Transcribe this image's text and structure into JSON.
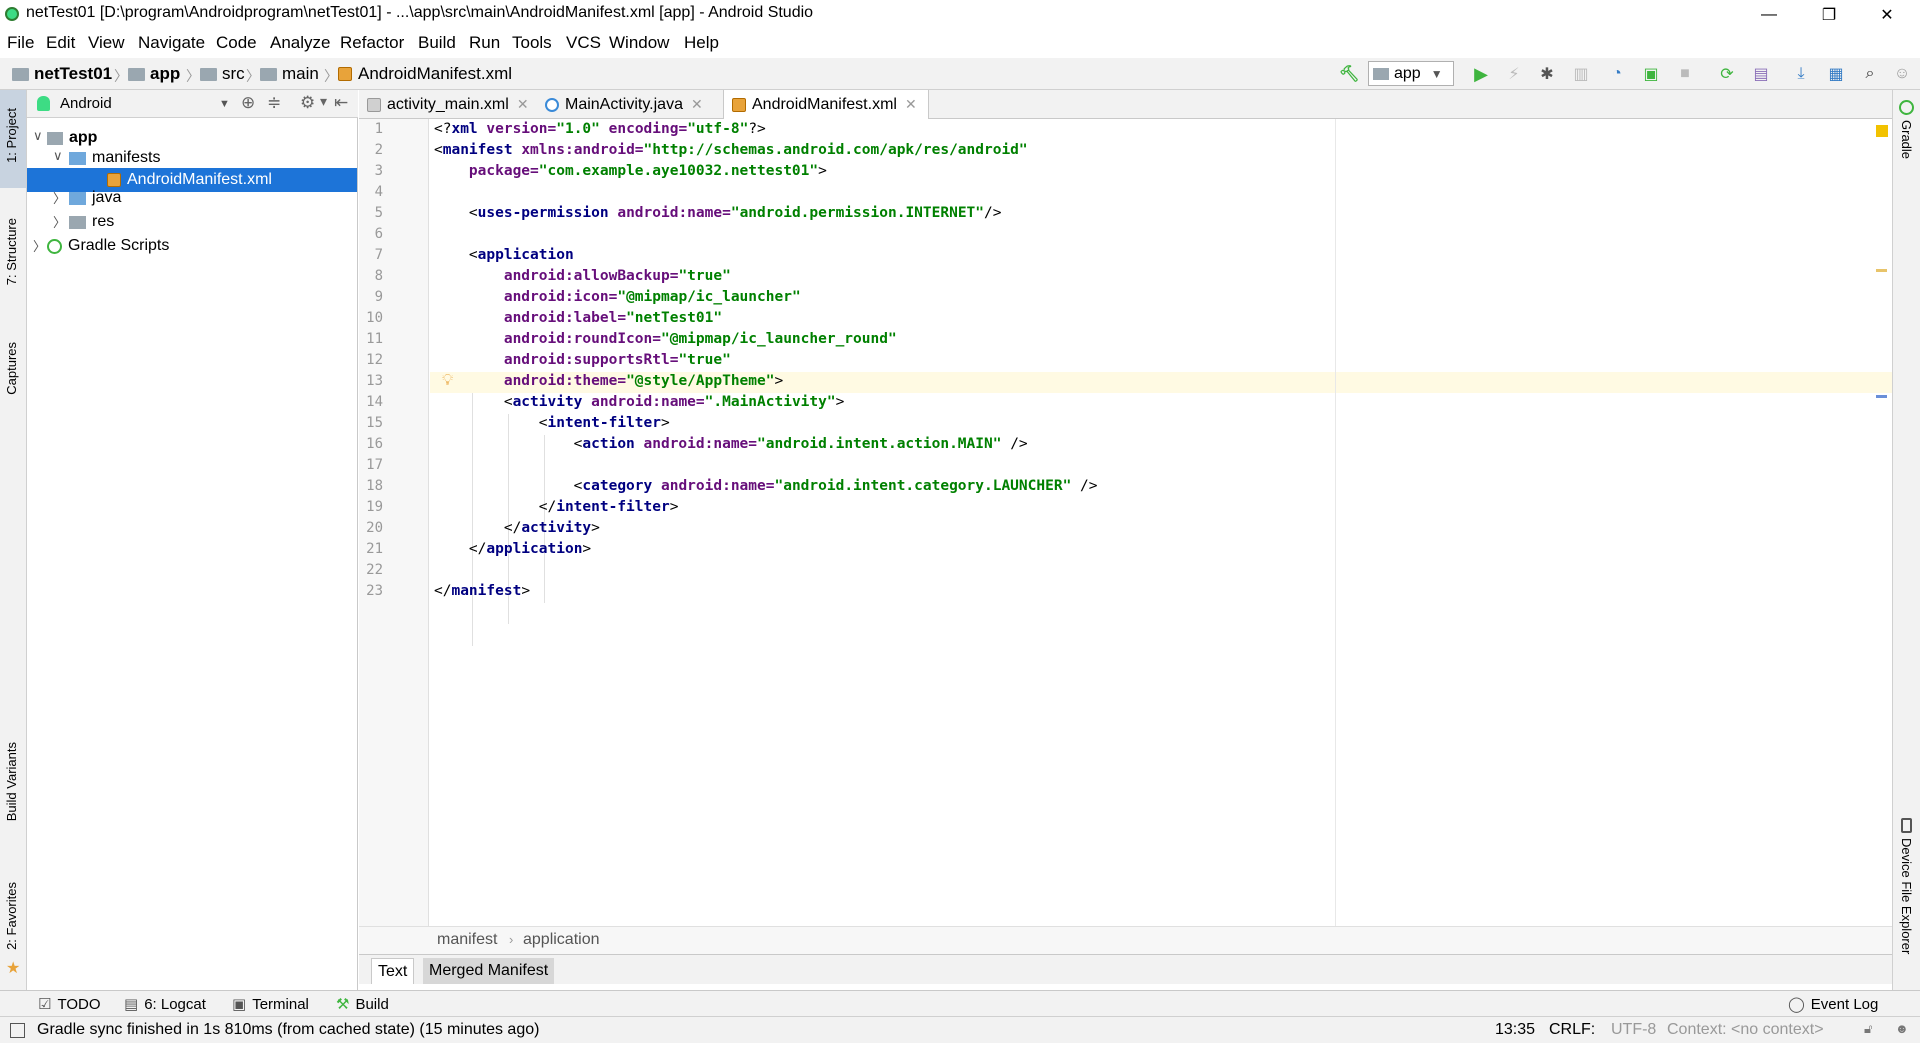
{
  "window": {
    "title": "netTest01 [D:\\program\\Androidprogram\\netTest01] - ...\\app\\src\\main\\AndroidManifest.xml [app] - Android Studio",
    "minimize": "—",
    "restore": "❐",
    "close": "✕"
  },
  "menu": [
    "File",
    "Edit",
    "View",
    "Navigate",
    "Code",
    "Analyze",
    "Refactor",
    "Build",
    "Run",
    "Tools",
    "VCS",
    "Window",
    "Help"
  ],
  "breadcrumbs": [
    "netTest01",
    "app",
    "src",
    "main",
    "AndroidManifest.xml"
  ],
  "toolbar": {
    "run_config": "app",
    "icons": [
      "hammer-icon",
      "run-icon",
      "apply-changes-icon",
      "debug-icon",
      "coverage-icon",
      "profile-icon",
      "attach-debugger-icon",
      "stop-icon",
      "sync-icon",
      "avd-manager-icon",
      "sdk-manager-icon",
      "project-structure-icon",
      "search-icon",
      "user-icon"
    ]
  },
  "left_tool_tabs": {
    "project": "1: Project",
    "structure": "7: Structure",
    "captures": "Captures",
    "build_variants": "Build Variants",
    "favorites": "2: Favorites"
  },
  "right_tool_tabs": {
    "gradle": "Gradle",
    "device_file_explorer": "Device File Explorer"
  },
  "project_panel": {
    "view_mode": "Android",
    "tree": [
      {
        "label": "app",
        "expanded": true
      },
      {
        "label": "manifests",
        "expanded": true
      },
      {
        "label": "AndroidManifest.xml",
        "selected": true
      },
      {
        "label": "java",
        "expanded": false
      },
      {
        "label": "res",
        "expanded": false
      },
      {
        "label": "Gradle Scripts",
        "expanded": false
      }
    ]
  },
  "editor_tabs": [
    {
      "label": "activity_main.xml",
      "active": false
    },
    {
      "label": "MainActivity.java",
      "active": false
    },
    {
      "label": "AndroidManifest.xml",
      "active": true
    }
  ],
  "code": {
    "line_numbers": [
      "1",
      "2",
      "3",
      "4",
      "5",
      "6",
      "7",
      "8",
      "9",
      "10",
      "11",
      "12",
      "13",
      "14",
      "15",
      "16",
      "17",
      "18",
      "19",
      "20",
      "21",
      "22",
      "23"
    ],
    "lines": [
      [
        [
          "txt",
          "<?"
        ],
        [
          "tag",
          "xml "
        ],
        [
          "attr",
          "version="
        ],
        [
          "val",
          "\"1.0\" "
        ],
        [
          "attr",
          "encoding="
        ],
        [
          "val",
          "\"utf-8\""
        ],
        [
          "txt",
          "?>"
        ]
      ],
      [
        [
          "txt",
          "<"
        ],
        [
          "tag",
          "manifest "
        ],
        [
          "attr",
          "xmlns:android="
        ],
        [
          "val",
          "\"http://schemas.android.com/apk/res/android\""
        ]
      ],
      [
        [
          "txt",
          "    "
        ],
        [
          "attr",
          "package="
        ],
        [
          "val",
          "\"com.example.aye10032.nettest01\""
        ],
        [
          "txt",
          ">"
        ]
      ],
      [],
      [
        [
          "txt",
          "    <"
        ],
        [
          "tag",
          "uses-permission "
        ],
        [
          "attr",
          "android:name="
        ],
        [
          "val",
          "\"android.permission.INTERNET\""
        ],
        [
          "txt",
          "/>"
        ]
      ],
      [],
      [
        [
          "txt",
          "    <"
        ],
        [
          "tag",
          "application"
        ]
      ],
      [
        [
          "txt",
          "        "
        ],
        [
          "attr",
          "android:allowBackup="
        ],
        [
          "val",
          "\"true\""
        ]
      ],
      [
        [
          "txt",
          "        "
        ],
        [
          "attr",
          "android:icon="
        ],
        [
          "val",
          "\"@mipmap/ic_launcher\""
        ]
      ],
      [
        [
          "txt",
          "        "
        ],
        [
          "attr",
          "android:label="
        ],
        [
          "val",
          "\"netTest01\""
        ]
      ],
      [
        [
          "txt",
          "        "
        ],
        [
          "attr",
          "android:roundIcon="
        ],
        [
          "val",
          "\"@mipmap/ic_launcher_round\""
        ]
      ],
      [
        [
          "txt",
          "        "
        ],
        [
          "attr",
          "android:supportsRtl="
        ],
        [
          "val",
          "\"true\""
        ]
      ],
      [
        [
          "txt",
          "        "
        ],
        [
          "attr",
          "android:theme="
        ],
        [
          "val",
          "\"@style/AppTheme\""
        ],
        [
          "txt",
          ">"
        ]
      ],
      [
        [
          "txt",
          "        <"
        ],
        [
          "tag",
          "activity "
        ],
        [
          "attr",
          "android:name="
        ],
        [
          "val",
          "\".MainActivity\""
        ],
        [
          "txt",
          ">"
        ]
      ],
      [
        [
          "txt",
          "            <"
        ],
        [
          "tag",
          "intent-filter"
        ],
        [
          "txt",
          ">"
        ]
      ],
      [
        [
          "txt",
          "                <"
        ],
        [
          "tag",
          "action "
        ],
        [
          "attr",
          "android:name="
        ],
        [
          "val",
          "\"android.intent.action.MAIN\" "
        ],
        [
          "txt",
          "/>"
        ]
      ],
      [],
      [
        [
          "txt",
          "                <"
        ],
        [
          "tag",
          "category "
        ],
        [
          "attr",
          "android:name="
        ],
        [
          "val",
          "\"android.intent.category.LAUNCHER\" "
        ],
        [
          "txt",
          "/>"
        ]
      ],
      [
        [
          "txt",
          "            </"
        ],
        [
          "tag",
          "intent-filter"
        ],
        [
          "txt",
          ">"
        ]
      ],
      [
        [
          "txt",
          "        </"
        ],
        [
          "tag",
          "activity"
        ],
        [
          "txt",
          ">"
        ]
      ],
      [
        [
          "txt",
          "    </"
        ],
        [
          "tag",
          "application"
        ],
        [
          "txt",
          ">"
        ]
      ],
      [],
      [
        [
          "txt",
          "</"
        ],
        [
          "tag",
          "manifest"
        ],
        [
          "txt",
          ">"
        ]
      ]
    ]
  },
  "editor_breadcrumb": [
    "manifest",
    "application"
  ],
  "editor_subtabs": [
    "Text",
    "Merged Manifest"
  ],
  "bottom_tools": [
    "TODO",
    "6: Logcat",
    "Terminal",
    "Build"
  ],
  "event_log": "Event Log",
  "status": {
    "message": "Gradle sync finished in 1s 810ms (from cached state) (15 minutes ago)",
    "position": "13:35",
    "line_separator": "CRLF:",
    "encoding": "UTF-8",
    "context": "Context: <no context>"
  },
  "colors": {
    "selection": "#1d74d8",
    "tag": "#000080",
    "attribute": "#660e7a",
    "value": "#008000",
    "run_green": "#3fb53f"
  }
}
